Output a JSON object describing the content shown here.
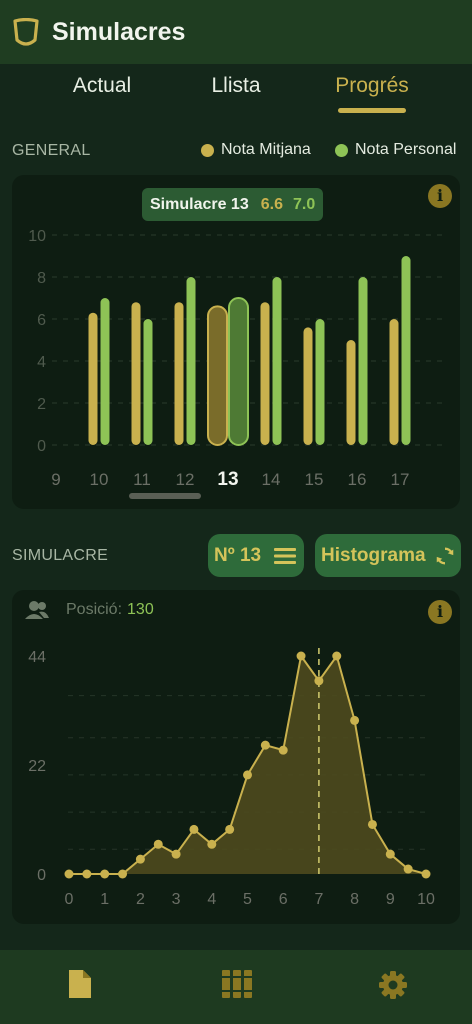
{
  "app": {
    "title": "Simulacres"
  },
  "tabs": [
    {
      "label": "Actual",
      "active": false
    },
    {
      "label": "Llista",
      "active": false
    },
    {
      "label": "Progrés",
      "active": true
    }
  ],
  "general": {
    "section_label": "GENERAL",
    "legend": [
      {
        "name": "Nota Mitjana",
        "color": "#c9b14e"
      },
      {
        "name": "Nota Personal",
        "color": "#8ec356"
      }
    ],
    "tooltip": {
      "title": "Simulacre 13",
      "mean": "6.6",
      "personal": "7.0"
    },
    "info_icon": "info-icon"
  },
  "chart_data": [
    {
      "type": "bar",
      "categories": [
        "10",
        "11",
        "12",
        "13",
        "14",
        "15",
        "16",
        "17"
      ],
      "partial_left_label": "9",
      "selected": "13",
      "series": [
        {
          "name": "Nota Mitjana",
          "color": "#c9b14e",
          "values": [
            6.3,
            6.8,
            6.8,
            6.6,
            6.8,
            5.6,
            5.0,
            6.0
          ]
        },
        {
          "name": "Nota Personal",
          "color": "#8ec356",
          "values": [
            7.0,
            6.0,
            8.0,
            7.0,
            8.0,
            6.0,
            8.0,
            9.0
          ]
        }
      ],
      "yticks": [
        "0",
        "2",
        "4",
        "6",
        "8",
        "10"
      ],
      "ylim": [
        0,
        10
      ],
      "grid": true
    },
    {
      "type": "area",
      "x": [
        0,
        0.5,
        1,
        1.5,
        2,
        2.5,
        3,
        3.5,
        4,
        4.5,
        5,
        5.5,
        6,
        6.5,
        7,
        7.5,
        8,
        8.5,
        9,
        9.5,
        10
      ],
      "y": [
        0,
        0,
        0,
        0,
        3,
        6,
        4,
        9,
        6,
        9,
        20,
        26,
        25,
        44,
        39,
        44,
        31,
        10,
        4,
        1,
        0
      ],
      "xticks": [
        "0",
        "1",
        "2",
        "3",
        "4",
        "5",
        "6",
        "7",
        "8",
        "9",
        "10"
      ],
      "yticks": [
        "0",
        "22",
        "44"
      ],
      "ylim": [
        0,
        44
      ],
      "xlim": [
        0,
        10
      ],
      "marker_x": 7,
      "grid": true,
      "color": "#c9b14e"
    }
  ],
  "simulacre": {
    "section_label": "SIMULACRE",
    "number_button": "Nº 13",
    "histogram_button": "Histograma",
    "position_label": "Posició:",
    "position_value": "130"
  },
  "bottom_nav": [
    {
      "icon": "document-icon",
      "active": true
    },
    {
      "icon": "books-icon",
      "active": false
    },
    {
      "icon": "gear-icon",
      "active": false
    }
  ]
}
